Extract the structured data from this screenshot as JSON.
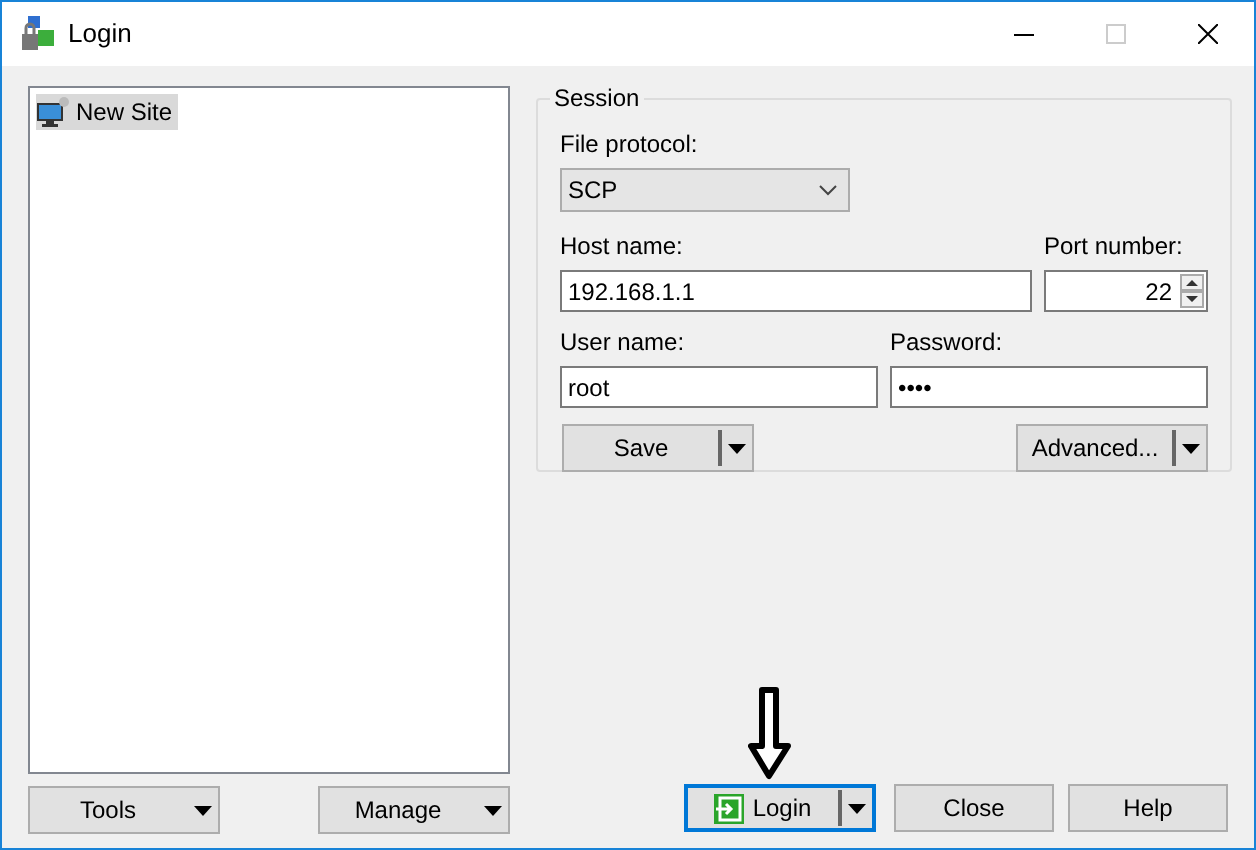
{
  "window": {
    "title": "Login",
    "controls": [
      {
        "kind": "minimize",
        "disabled": false
      },
      {
        "kind": "maximize",
        "disabled": true
      },
      {
        "kind": "close",
        "disabled": false
      }
    ]
  },
  "site_tree": {
    "items": [
      {
        "label": "New Site",
        "selected": true
      }
    ]
  },
  "session": {
    "title": "Session",
    "file_protocol": {
      "label": "File protocol:",
      "value": "SCP"
    },
    "host_name": {
      "label": "Host name:",
      "value": "192.168.1.1"
    },
    "port_number": {
      "label": "Port number:",
      "value": "22"
    },
    "user_name": {
      "label": "User name:",
      "value": "root"
    },
    "password": {
      "label": "Password:",
      "value": "••••"
    },
    "buttons": [
      {
        "label": "Save",
        "split": true
      },
      {
        "label": "Advanced...",
        "split": true
      }
    ]
  },
  "left_buttons": [
    {
      "label": "Tools",
      "split": true
    },
    {
      "label": "Manage",
      "split": true
    }
  ],
  "dialog_buttons": [
    {
      "label": "Login",
      "kind": "login",
      "default": true,
      "split": true
    },
    {
      "label": "Close",
      "kind": "plain",
      "default": false,
      "split": false
    },
    {
      "label": "Help",
      "kind": "plain",
      "default": false,
      "split": false
    }
  ]
}
